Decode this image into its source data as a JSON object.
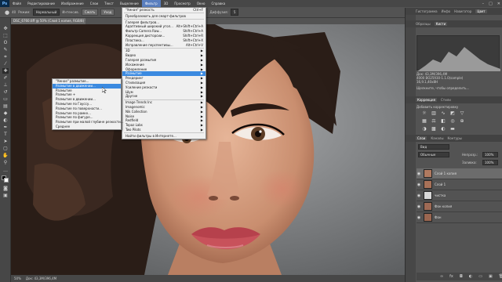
{
  "app": {
    "logo": "Ps"
  },
  "menubar": {
    "items": [
      "Файл",
      "Редактирование",
      "Изображение",
      "Слои",
      "Текст",
      "Выделение",
      "Фильтр",
      "3D",
      "Просмотр",
      "Окно",
      "Справка"
    ],
    "active": "Фильтр",
    "window_buttons": [
      "–",
      "□",
      "✕"
    ]
  },
  "options": {
    "size": "40",
    "mode_label": "Режим:",
    "mode_value": "Нормальный",
    "opacity_label": "Интенсив.",
    "btn1": "Сжать",
    "btn2": "Уход",
    "strength_label": "Диффузия:",
    "strength_value": "5"
  },
  "document": {
    "tab": "DSC_6760.tiff @ 50% (Слой 1 копия, RGB/8) *"
  },
  "status": {
    "zoom": "50%",
    "doc": "Док: 43,3M/396,4M"
  },
  "filter_menu": {
    "items": [
      {
        "label": "\"Умная\" резкость",
        "shortcut": "Ctrl+F"
      },
      {
        "sep": true
      },
      {
        "label": "Преобразовать для смарт-фильтров"
      },
      {
        "sep": true
      },
      {
        "label": "Галерея фильтров..."
      },
      {
        "label": "Адаптивный широкий угол...",
        "shortcut": "Alt+Shift+Ctrl+A"
      },
      {
        "label": "Фильтр Camera Raw...",
        "shortcut": "Shift+Ctrl+A"
      },
      {
        "label": "Коррекция дисторсии...",
        "shortcut": "Shift+Ctrl+R"
      },
      {
        "label": "Пластика...",
        "shortcut": "Shift+Ctrl+X"
      },
      {
        "label": "Исправление перспективы...",
        "shortcut": "Alt+Ctrl+V"
      },
      {
        "sep": true
      },
      {
        "label": "3D",
        "arrow": true
      },
      {
        "label": "Видео",
        "arrow": true
      },
      {
        "label": "Галерея размытия",
        "arrow": true
      },
      {
        "label": "Искажение",
        "arrow": true
      },
      {
        "label": "Оформление",
        "arrow": true
      },
      {
        "label": "Размытие",
        "arrow": true,
        "selected": true
      },
      {
        "label": "Рендеринг",
        "arrow": true
      },
      {
        "label": "Стилизация",
        "arrow": true
      },
      {
        "label": "Усиление резкости",
        "arrow": true
      },
      {
        "label": "Шум",
        "arrow": true
      },
      {
        "label": "Другие",
        "arrow": true
      },
      {
        "sep": true
      },
      {
        "label": "Image Trends Inc",
        "arrow": true
      },
      {
        "label": "Imagenomic",
        "arrow": true
      },
      {
        "label": "Nik Collection",
        "arrow": true
      },
      {
        "label": "Noise",
        "arrow": true
      },
      {
        "label": "Redfield",
        "arrow": true
      },
      {
        "label": "Topaz Labs",
        "arrow": true
      },
      {
        "label": "Two Pilots",
        "arrow": true
      },
      {
        "sep": true
      },
      {
        "label": "Найти фильтры в Интернете..."
      }
    ]
  },
  "blur_submenu": {
    "items": [
      {
        "label": "\"Умное\" размытие..."
      },
      {
        "label": "Размытие в движении...",
        "selected": true
      },
      {
        "label": "Размытие"
      },
      {
        "label": "Размытие +"
      },
      {
        "label": "Размытие в движении..."
      },
      {
        "label": "Размытие по Гауссу..."
      },
      {
        "label": "Размытие по поверхности..."
      },
      {
        "label": "Размытие по рамке..."
      },
      {
        "label": "Размытие по фигуре..."
      },
      {
        "label": "Размытие при малой глубине резкости..."
      },
      {
        "label": "Среднее"
      }
    ]
  },
  "panels": {
    "top_tabs": [
      "Гистограмма",
      "Инфо",
      "Навигатор",
      "Цвет",
      "Образцы",
      "Кисти"
    ],
    "info_tab": "Инфо",
    "info_text": "Док: 43,3M/396,4M\n4000 ВО25930-1.1.0(sample)\n16,9.1,40x8H",
    "hint_text": "Щелкните, чтобы определить...",
    "adjust_tabs": [
      "Коррекция",
      "Стили"
    ],
    "adjust_title": "Добавить корректировку",
    "layers_tabs": [
      "Слои",
      "Каналы",
      "Контуры"
    ],
    "kind_label": "Вид",
    "blend_value": "Обычные",
    "opacity_label": "Непрозр.:",
    "opacity_value": "100%",
    "fill_label": "Заливка:",
    "fill_value": "100%",
    "layers": [
      {
        "name": "Слой 1 копия",
        "selected": true
      },
      {
        "name": "Слой 1"
      },
      {
        "name": "чистка"
      },
      {
        "name": "Фон копия"
      },
      {
        "name": "Фон"
      }
    ]
  },
  "colors": {
    "accent": "#3b8ae0",
    "menu_active": "#5a7fbf"
  }
}
